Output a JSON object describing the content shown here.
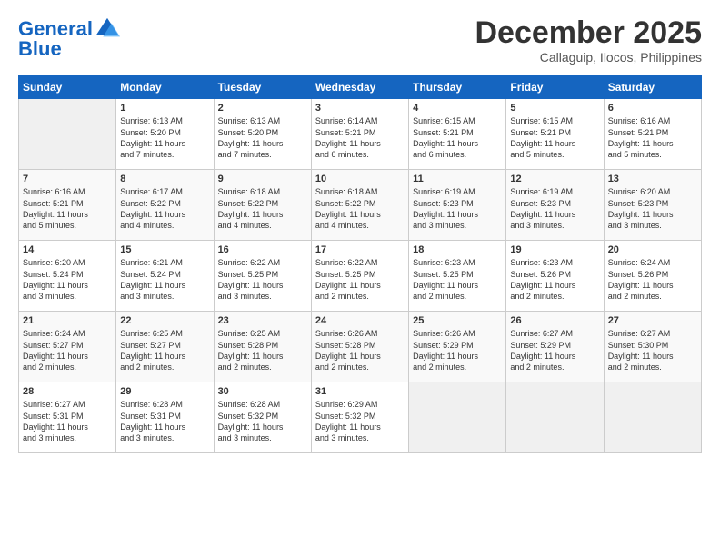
{
  "logo": {
    "line1": "General",
    "line2": "Blue"
  },
  "title": "December 2025",
  "subtitle": "Callaguip, Ilocos, Philippines",
  "days_of_week": [
    "Sunday",
    "Monday",
    "Tuesday",
    "Wednesday",
    "Thursday",
    "Friday",
    "Saturday"
  ],
  "weeks": [
    [
      {
        "day": "",
        "info": ""
      },
      {
        "day": "1",
        "info": "Sunrise: 6:13 AM\nSunset: 5:20 PM\nDaylight: 11 hours\nand 7 minutes."
      },
      {
        "day": "2",
        "info": "Sunrise: 6:13 AM\nSunset: 5:20 PM\nDaylight: 11 hours\nand 7 minutes."
      },
      {
        "day": "3",
        "info": "Sunrise: 6:14 AM\nSunset: 5:21 PM\nDaylight: 11 hours\nand 6 minutes."
      },
      {
        "day": "4",
        "info": "Sunrise: 6:15 AM\nSunset: 5:21 PM\nDaylight: 11 hours\nand 6 minutes."
      },
      {
        "day": "5",
        "info": "Sunrise: 6:15 AM\nSunset: 5:21 PM\nDaylight: 11 hours\nand 5 minutes."
      },
      {
        "day": "6",
        "info": "Sunrise: 6:16 AM\nSunset: 5:21 PM\nDaylight: 11 hours\nand 5 minutes."
      }
    ],
    [
      {
        "day": "7",
        "info": "Sunrise: 6:16 AM\nSunset: 5:21 PM\nDaylight: 11 hours\nand 5 minutes."
      },
      {
        "day": "8",
        "info": "Sunrise: 6:17 AM\nSunset: 5:22 PM\nDaylight: 11 hours\nand 4 minutes."
      },
      {
        "day": "9",
        "info": "Sunrise: 6:18 AM\nSunset: 5:22 PM\nDaylight: 11 hours\nand 4 minutes."
      },
      {
        "day": "10",
        "info": "Sunrise: 6:18 AM\nSunset: 5:22 PM\nDaylight: 11 hours\nand 4 minutes."
      },
      {
        "day": "11",
        "info": "Sunrise: 6:19 AM\nSunset: 5:23 PM\nDaylight: 11 hours\nand 3 minutes."
      },
      {
        "day": "12",
        "info": "Sunrise: 6:19 AM\nSunset: 5:23 PM\nDaylight: 11 hours\nand 3 minutes."
      },
      {
        "day": "13",
        "info": "Sunrise: 6:20 AM\nSunset: 5:23 PM\nDaylight: 11 hours\nand 3 minutes."
      }
    ],
    [
      {
        "day": "14",
        "info": "Sunrise: 6:20 AM\nSunset: 5:24 PM\nDaylight: 11 hours\nand 3 minutes."
      },
      {
        "day": "15",
        "info": "Sunrise: 6:21 AM\nSunset: 5:24 PM\nDaylight: 11 hours\nand 3 minutes."
      },
      {
        "day": "16",
        "info": "Sunrise: 6:22 AM\nSunset: 5:25 PM\nDaylight: 11 hours\nand 3 minutes."
      },
      {
        "day": "17",
        "info": "Sunrise: 6:22 AM\nSunset: 5:25 PM\nDaylight: 11 hours\nand 2 minutes."
      },
      {
        "day": "18",
        "info": "Sunrise: 6:23 AM\nSunset: 5:25 PM\nDaylight: 11 hours\nand 2 minutes."
      },
      {
        "day": "19",
        "info": "Sunrise: 6:23 AM\nSunset: 5:26 PM\nDaylight: 11 hours\nand 2 minutes."
      },
      {
        "day": "20",
        "info": "Sunrise: 6:24 AM\nSunset: 5:26 PM\nDaylight: 11 hours\nand 2 minutes."
      }
    ],
    [
      {
        "day": "21",
        "info": "Sunrise: 6:24 AM\nSunset: 5:27 PM\nDaylight: 11 hours\nand 2 minutes."
      },
      {
        "day": "22",
        "info": "Sunrise: 6:25 AM\nSunset: 5:27 PM\nDaylight: 11 hours\nand 2 minutes."
      },
      {
        "day": "23",
        "info": "Sunrise: 6:25 AM\nSunset: 5:28 PM\nDaylight: 11 hours\nand 2 minutes."
      },
      {
        "day": "24",
        "info": "Sunrise: 6:26 AM\nSunset: 5:28 PM\nDaylight: 11 hours\nand 2 minutes."
      },
      {
        "day": "25",
        "info": "Sunrise: 6:26 AM\nSunset: 5:29 PM\nDaylight: 11 hours\nand 2 minutes."
      },
      {
        "day": "26",
        "info": "Sunrise: 6:27 AM\nSunset: 5:29 PM\nDaylight: 11 hours\nand 2 minutes."
      },
      {
        "day": "27",
        "info": "Sunrise: 6:27 AM\nSunset: 5:30 PM\nDaylight: 11 hours\nand 2 minutes."
      }
    ],
    [
      {
        "day": "28",
        "info": "Sunrise: 6:27 AM\nSunset: 5:31 PM\nDaylight: 11 hours\nand 3 minutes."
      },
      {
        "day": "29",
        "info": "Sunrise: 6:28 AM\nSunset: 5:31 PM\nDaylight: 11 hours\nand 3 minutes."
      },
      {
        "day": "30",
        "info": "Sunrise: 6:28 AM\nSunset: 5:32 PM\nDaylight: 11 hours\nand 3 minutes."
      },
      {
        "day": "31",
        "info": "Sunrise: 6:29 AM\nSunset: 5:32 PM\nDaylight: 11 hours\nand 3 minutes."
      },
      {
        "day": "",
        "info": ""
      },
      {
        "day": "",
        "info": ""
      },
      {
        "day": "",
        "info": ""
      }
    ]
  ]
}
